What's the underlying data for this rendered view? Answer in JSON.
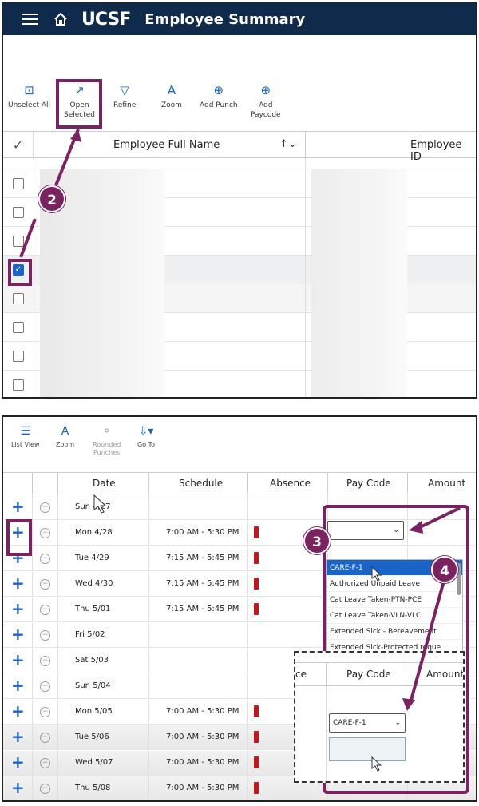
{
  "app": {
    "logo": "UCSF",
    "title": "Employee Summary"
  },
  "toolbar": [
    {
      "icon": "unselect-icon",
      "label": "Unselect All"
    },
    {
      "icon": "open-icon",
      "label": "Open\nSelected"
    },
    {
      "icon": "filter-icon",
      "label": "Refine"
    },
    {
      "icon": "zoom-icon",
      "label": "Zoom"
    },
    {
      "icon": "add-punch-icon",
      "label": "Add Punch"
    },
    {
      "icon": "add-paycode-icon",
      "label": "Add\nPaycode"
    }
  ],
  "grid": {
    "headers": {
      "name": "Employee Full Name",
      "id": "Employee ID"
    },
    "rows": [
      {
        "selected": false
      },
      {
        "selected": false
      },
      {
        "selected": false
      },
      {
        "selected": true
      },
      {
        "selected": false
      },
      {
        "selected": false
      },
      {
        "selected": false
      },
      {
        "selected": false
      }
    ]
  },
  "badges": {
    "b2": "2",
    "b3": "3",
    "b4": "4"
  },
  "timecard": {
    "toolbar": [
      {
        "icon": "list-view-icon",
        "label": "List View"
      },
      {
        "icon": "zoom-icon",
        "label": "Zoom"
      },
      {
        "icon": "rounded-punches-icon",
        "label": "Rounded\nPunches"
      },
      {
        "icon": "go-to-icon",
        "label": "Go To"
      }
    ],
    "headers": {
      "date": "Date",
      "schedule": "Schedule",
      "absence": "Absence",
      "paycode": "Pay Code",
      "amount": "Amount"
    },
    "rows": [
      {
        "date": "Sun 4/27",
        "schedule": "",
        "absence": false
      },
      {
        "date": "Mon 4/28",
        "schedule": "7:00 AM - 5:30 PM",
        "absence": true
      },
      {
        "date": "Tue 4/29",
        "schedule": "7:15 AM - 5:45 PM",
        "absence": true
      },
      {
        "date": "Wed 4/30",
        "schedule": "7:15 AM - 5:45 PM",
        "absence": true
      },
      {
        "date": "Thu 5/01",
        "schedule": "7:15 AM - 5:45 PM",
        "absence": true
      },
      {
        "date": "Fri 5/02",
        "schedule": "",
        "absence": false
      },
      {
        "date": "Sat 5/03",
        "schedule": "",
        "absence": false
      },
      {
        "date": "Sun 5/04",
        "schedule": "",
        "absence": false
      },
      {
        "date": "Mon 5/05",
        "schedule": "7:00 AM - 5:30 PM",
        "absence": true
      },
      {
        "date": "Tue 5/06",
        "schedule": "7:00 AM - 5:30 PM",
        "absence": true
      },
      {
        "date": "Wed 5/07",
        "schedule": "7:00 AM - 5:30 PM",
        "absence": true
      },
      {
        "date": "Thu 5/08",
        "schedule": "7:00 AM - 5:30 PM",
        "absence": true
      }
    ],
    "paycode_options": [
      "CARE-F-1",
      "Authorized Unpaid Leave",
      "Cat Leave Taken-PTN-PCE",
      "Cat Leave Taken-VLN-VLC",
      "Extended Sick - Bereavement",
      "Extended Sick-Protected reque"
    ],
    "inset": {
      "absence_partial": "ce",
      "paycode": "Pay Code",
      "amount": "Amount",
      "selected_value": "CARE-F-1"
    }
  },
  "colors": {
    "header_bg": "#0f2a4a",
    "accent": "#1a64c8",
    "annotation": "#7b2360",
    "absence": "#c4161c"
  }
}
